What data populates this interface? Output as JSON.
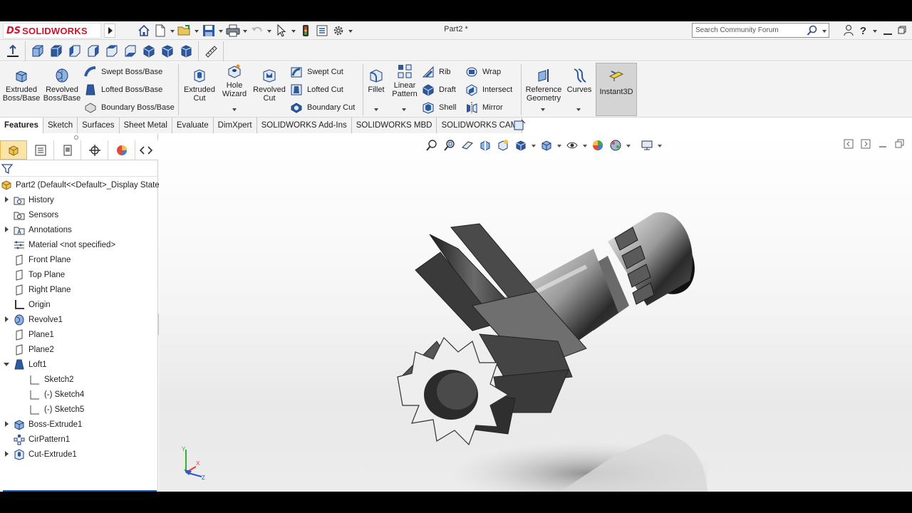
{
  "app": {
    "brand_prefix": "DS",
    "brand_name": "SOLIDWORKS",
    "document_title": "Part2 *",
    "search_placeholder": "Search Community Forum",
    "help_label": "?"
  },
  "ribbon": {
    "extruded_boss": "Extruded Boss/Base",
    "revolved_boss": "Revolved Boss/Base",
    "swept_boss": "Swept Boss/Base",
    "lofted_boss": "Lofted Boss/Base",
    "boundary_boss": "Boundary Boss/Base",
    "extruded_cut": "Extruded Cut",
    "hole_wizard": "Hole Wizard",
    "revolved_cut": "Revolved Cut",
    "swept_cut": "Swept Cut",
    "lofted_cut": "Lofted Cut",
    "boundary_cut": "Boundary Cut",
    "fillet": "Fillet",
    "linear_pattern": "Linear Pattern",
    "rib": "Rib",
    "draft": "Draft",
    "shell": "Shell",
    "wrap": "Wrap",
    "intersect": "Intersect",
    "mirror": "Mirror",
    "reference_geometry": "Reference Geometry",
    "curves": "Curves",
    "instant3d": "Instant3D"
  },
  "tabs": [
    "Features",
    "Sketch",
    "Surfaces",
    "Sheet Metal",
    "Evaluate",
    "DimXpert",
    "SOLIDWORKS Add-Ins",
    "SOLIDWORKS MBD",
    "SOLIDWORKS CAM"
  ],
  "tree": {
    "root": "Part2  (Default<<Default>_Display State",
    "items": [
      {
        "label": "History"
      },
      {
        "label": "Sensors"
      },
      {
        "label": "Annotations"
      },
      {
        "label": "Material <not specified>"
      },
      {
        "label": "Front Plane"
      },
      {
        "label": "Top Plane"
      },
      {
        "label": "Right Plane"
      },
      {
        "label": "Origin"
      },
      {
        "label": "Revolve1"
      },
      {
        "label": "Plane1"
      },
      {
        "label": "Plane2"
      },
      {
        "label": "Loft1"
      },
      {
        "label": "Sketch2"
      },
      {
        "label": "(-) Sketch4"
      },
      {
        "label": "(-) Sketch5"
      },
      {
        "label": "Boss-Extrude1"
      },
      {
        "label": "CirPattern1"
      },
      {
        "label": "Cut-Extrude1"
      }
    ]
  },
  "triad": {
    "x": "X",
    "y": "Y",
    "z": "Z"
  },
  "colors": {
    "brand": "#d3142a",
    "rollback": "#1a56b8",
    "active_tab": "#fbe4a8",
    "model_dark": "#2a2a2a"
  }
}
